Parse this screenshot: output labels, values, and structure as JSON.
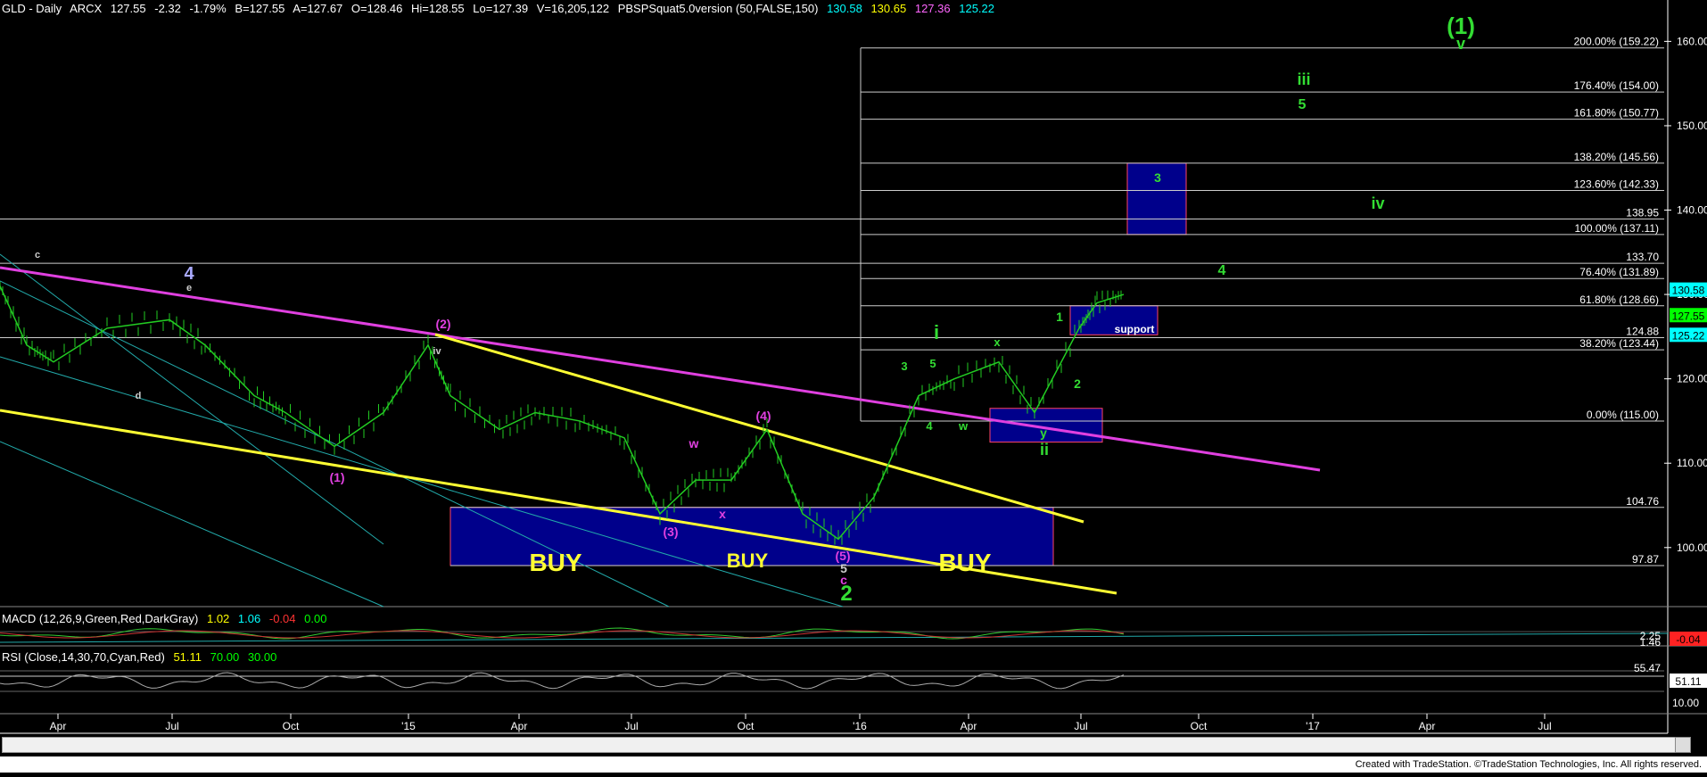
{
  "header": {
    "symbol": "GLD - Daily",
    "exchange": "ARCX",
    "last": "127.55",
    "change": "-2.32",
    "pct": "-1.79%",
    "bid": "B=127.55",
    "ask": "A=127.67",
    "open": "O=128.46",
    "high": "Hi=128.55",
    "low": "Lo=127.39",
    "volume": "V=16,205,122",
    "study": "PBSPSquat5.0version (50,FALSE,150)",
    "v1": "130.58",
    "v2": "130.65",
    "v3": "127.36",
    "v4": "125.22"
  },
  "colors": {
    "bg": "#000000",
    "price": "#22cc22",
    "magenta": "#e040e0",
    "yellow": "#ffff33",
    "cyan": "#22aaaa",
    "blue_box": "#00008b",
    "green_label": "#33dd33",
    "white": "#ffffff"
  },
  "chart_data": {
    "type": "line",
    "title": "GLD - Daily",
    "ylim": [
      93,
      163
    ],
    "x_tick_labels": [
      "Apr",
      "Jul",
      "Oct",
      "'15",
      "Apr",
      "Jul",
      "Oct",
      "'16",
      "Apr",
      "Jul",
      "Oct",
      "'17",
      "Apr",
      "Jul"
    ],
    "y_tick_labels": [
      "160.00",
      "150.00",
      "140.00",
      "130.00",
      "120.00",
      "110.00",
      "100.00"
    ],
    "fib_levels": [
      {
        "label": "200.00% (159.22)",
        "value": 159.22
      },
      {
        "label": "176.40% (154.00)",
        "value": 154.0
      },
      {
        "label": "161.80% (150.77)",
        "value": 150.77
      },
      {
        "label": "138.20% (145.56)",
        "value": 145.56
      },
      {
        "label": "123.60% (142.33)",
        "value": 142.33
      },
      {
        "label": "100.00% (137.11)",
        "value": 137.11
      },
      {
        "label": "76.40% (131.89)",
        "value": 131.89
      },
      {
        "label": "61.80% (128.66)",
        "value": 128.66
      },
      {
        "label": "38.20% (123.44)",
        "value": 123.44
      },
      {
        "label": "0.00% (115.00)",
        "value": 115.0
      }
    ],
    "level_labels": [
      {
        "label": "138.95",
        "value": 138.95
      },
      {
        "label": "133.70",
        "value": 133.7
      },
      {
        "label": "124.88",
        "value": 124.88
      },
      {
        "label": "104.76",
        "value": 104.76
      },
      {
        "label": "97.87",
        "value": 97.87
      }
    ],
    "price_tags": [
      {
        "label": "130.58",
        "value": 130.58,
        "color": "#00ffff"
      },
      {
        "label": "127.55",
        "value": 127.55,
        "color": "#00ff00"
      },
      {
        "label": "125.22",
        "value": 125.22,
        "color": "#00ffff"
      }
    ],
    "annotations": [
      {
        "text": "(1)",
        "color": "#33dd33"
      },
      {
        "text": "v",
        "color": "#33dd33"
      },
      {
        "text": "iii",
        "color": "#33dd33"
      },
      {
        "text": "5",
        "color": "#33dd33"
      },
      {
        "text": "3",
        "color": "#33dd33"
      },
      {
        "text": "iv",
        "color": "#33dd33"
      },
      {
        "text": "4",
        "color": "#33dd33"
      },
      {
        "text": "1",
        "color": "#33dd33"
      },
      {
        "text": "support",
        "color": "#ffffff"
      },
      {
        "text": "2",
        "color": "#33dd33"
      },
      {
        "text": "i",
        "color": "#33dd33"
      },
      {
        "text": "3",
        "color": "#33dd33"
      },
      {
        "text": "5",
        "color": "#33dd33"
      },
      {
        "text": "4",
        "color": "#33dd33"
      },
      {
        "text": "w",
        "color": "#33dd33"
      },
      {
        "text": "x",
        "color": "#33dd33"
      },
      {
        "text": "y",
        "color": "#33dd33"
      },
      {
        "text": "ii",
        "color": "#33dd33"
      },
      {
        "text": "c",
        "color": "#cccccc"
      },
      {
        "text": "4",
        "color": "#aaaaff"
      },
      {
        "text": "e",
        "color": "#cccccc"
      },
      {
        "text": "d",
        "color": "#cccccc"
      },
      {
        "text": "iv",
        "color": "#cccccc"
      },
      {
        "text": "(2)",
        "color": "#e040e0"
      },
      {
        "text": "(1)",
        "color": "#e040e0"
      },
      {
        "text": "(4)",
        "color": "#e040e0"
      },
      {
        "text": "w",
        "color": "#e040e0"
      },
      {
        "text": "x",
        "color": "#e040e0"
      },
      {
        "text": "(3)",
        "color": "#e040e0"
      },
      {
        "text": "(5)",
        "color": "#e040e0"
      },
      {
        "text": "5",
        "color": "#cccccc"
      },
      {
        "text": "c",
        "color": "#e040e0"
      },
      {
        "text": "2",
        "color": "#33dd33"
      },
      {
        "text": "BUY",
        "color": "#ffff33"
      },
      {
        "text": "BUY",
        "color": "#ffff33"
      },
      {
        "text": "BUY",
        "color": "#ffff33"
      }
    ],
    "series": [
      {
        "name": "GLD",
        "x": [
          "2014-03",
          "2014-04",
          "2014-05",
          "2014-06",
          "2014-07",
          "2014-08",
          "2014-09",
          "2014-10",
          "2014-11",
          "2014-12",
          "2015-01",
          "2015-02",
          "2015-03",
          "2015-04",
          "2015-05",
          "2015-06",
          "2015-07",
          "2015-08",
          "2015-09",
          "2015-10",
          "2015-11",
          "2015-12",
          "2016-01",
          "2016-02",
          "2016-03",
          "2016-04",
          "2016-05",
          "2016-06",
          "2016-07",
          "2016-08"
        ],
        "values": [
          131,
          124,
          122,
          126,
          127,
          124,
          118,
          116,
          112,
          116,
          124,
          118,
          114,
          116,
          115,
          113,
          104,
          108,
          108,
          114,
          104,
          101,
          106,
          118,
          120,
          122,
          116,
          126,
          129,
          130
        ]
      }
    ]
  },
  "macd": {
    "label": "MACD (12,26,9,Green,Red,DarkGray)",
    "v1": "1.02",
    "v2": "1.06",
    "v3": "-0.04",
    "v4": "0.00",
    "tags": [
      "2.25",
      "1.46",
      "-0.04"
    ]
  },
  "rsi": {
    "label": "RSI (Close,14,30,70,Cyan,Red)",
    "v1": "51.11",
    "v2": "70.00",
    "v3": "30.00",
    "tags": [
      "55.47",
      "51.11",
      "10.00"
    ]
  },
  "footer": "Created with TradeStation. ©TradeStation Technologies, Inc. All rights reserved."
}
